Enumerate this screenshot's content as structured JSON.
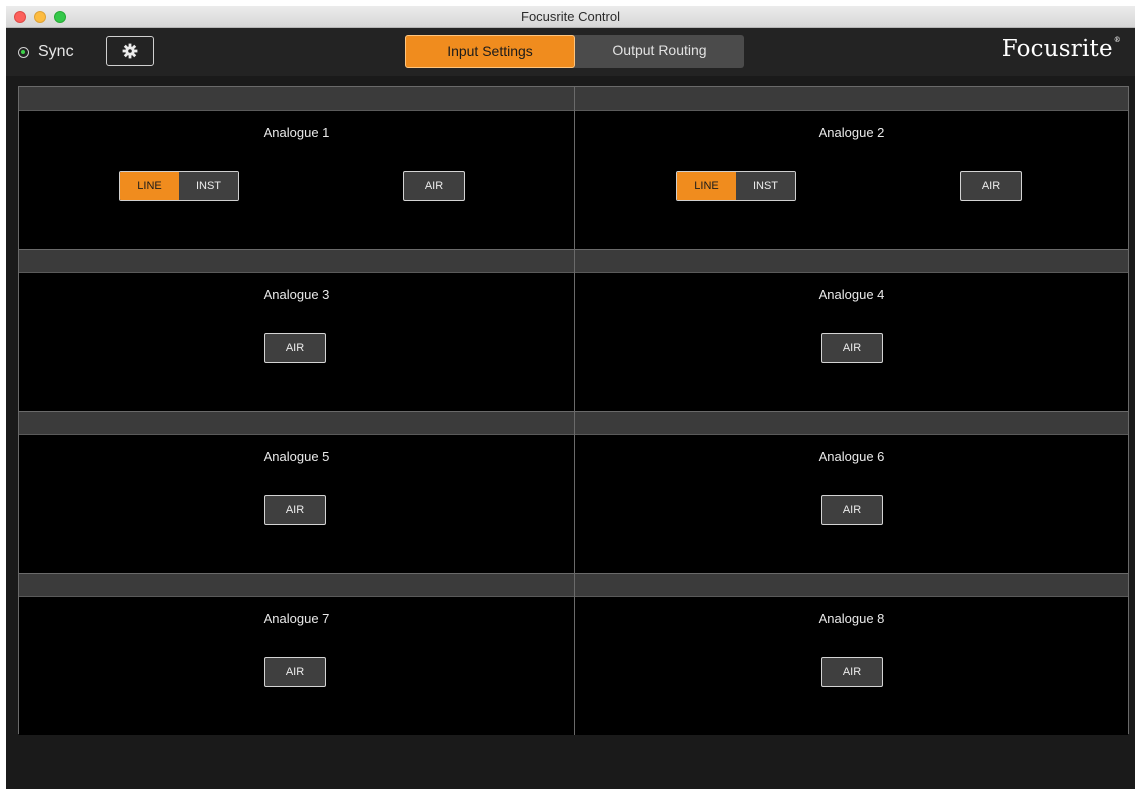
{
  "window": {
    "title": "Focusrite Control"
  },
  "toolbar": {
    "sync_label": "Sync",
    "tabs": [
      {
        "label": "Input Settings",
        "active": true
      },
      {
        "label": "Output Routing",
        "active": false
      }
    ],
    "brand": "Focusrite",
    "brand_mark": "®"
  },
  "colors": {
    "accent": "#f08c1e",
    "sync_indicator": "#3ed14a",
    "panel_bg": "#000000",
    "header_bg": "#3b3b3b"
  },
  "channels": [
    {
      "name": "Analogue 1",
      "has_line_inst": true,
      "line_label": "LINE",
      "inst_label": "INST",
      "selected": "LINE",
      "air_label": "AIR"
    },
    {
      "name": "Analogue 2",
      "has_line_inst": true,
      "line_label": "LINE",
      "inst_label": "INST",
      "selected": "LINE",
      "air_label": "AIR"
    },
    {
      "name": "Analogue 3",
      "has_line_inst": false,
      "air_label": "AIR"
    },
    {
      "name": "Analogue 4",
      "has_line_inst": false,
      "air_label": "AIR"
    },
    {
      "name": "Analogue 5",
      "has_line_inst": false,
      "air_label": "AIR"
    },
    {
      "name": "Analogue 6",
      "has_line_inst": false,
      "air_label": "AIR"
    },
    {
      "name": "Analogue 7",
      "has_line_inst": false,
      "air_label": "AIR"
    },
    {
      "name": "Analogue 8",
      "has_line_inst": false,
      "air_label": "AIR"
    }
  ],
  "icons": {
    "settings": "gear-icon",
    "sync": "radio-indicator-icon"
  }
}
